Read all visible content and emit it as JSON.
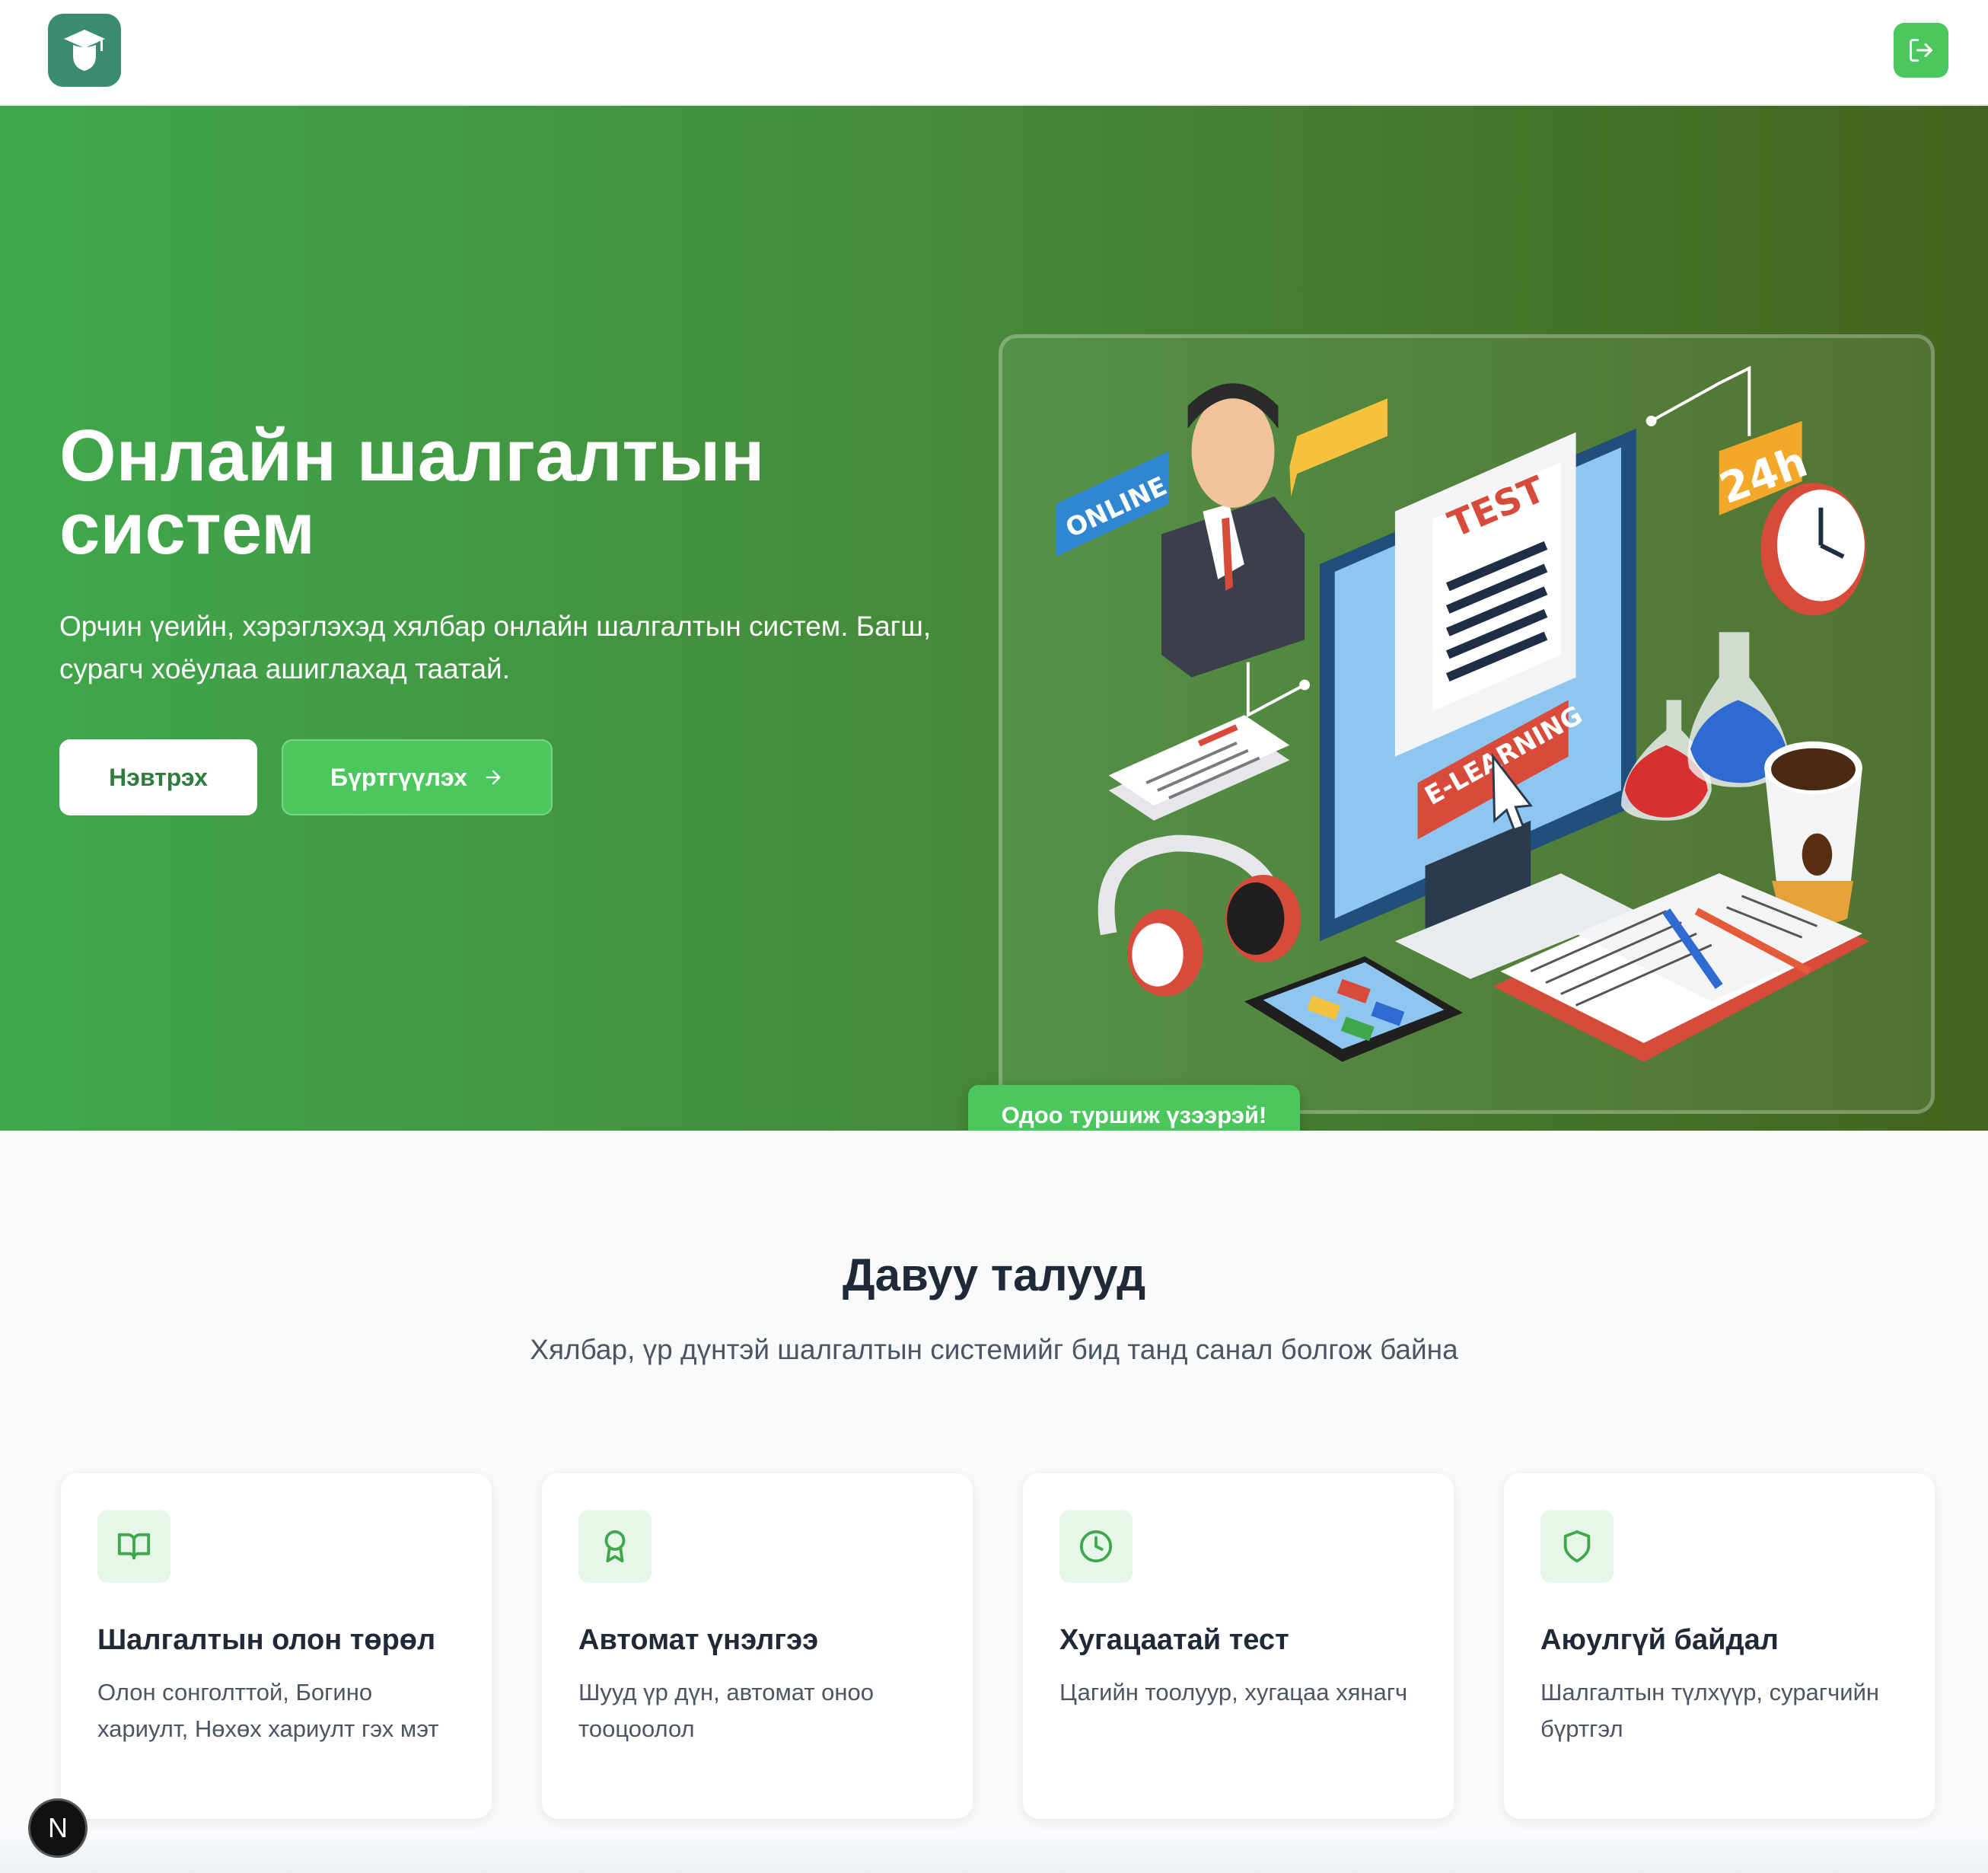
{
  "header": {
    "logo_icon": "graduate-logo-icon",
    "logout_icon": "logout-icon"
  },
  "hero": {
    "title": "Онлайн шалгалтын систем",
    "subtitle": "Орчин үеийн, хэрэглэхэд хялбар онлайн шалгалтын систем. Багш, сурагч хоёулаа ашиглахад таатай.",
    "login_label": "Нэвтрэх",
    "register_label": "Бүртгүүлэх",
    "register_icon": "arrow-right-icon",
    "try_badge": "Одоо туршиж үзээрэй!",
    "illustration": {
      "online_text": "ONLINE",
      "test_text": "TEST",
      "elearning_text": "E-LEARNING",
      "hours_text": "24h"
    }
  },
  "features": {
    "title": "Давуу талууд",
    "subtitle": "Хялбар, үр дүнтэй шалгалтын системийг бид танд санал болгож байна",
    "items": [
      {
        "icon": "book-open-icon",
        "title": "Шалгалтын олон төрөл",
        "description": "Олон сонголттой, Богино хариулт, Нөхөх хариулт гэх мэт"
      },
      {
        "icon": "award-icon",
        "title": "Автомат үнэлгээ",
        "description": "Шууд үр дүн, автомат оноо тооцоолол"
      },
      {
        "icon": "clock-icon",
        "title": "Хугацаатай тест",
        "description": "Цагийн тоолуур, хугацаа хянагч"
      },
      {
        "icon": "shield-icon",
        "title": "Аюулгүй байдал",
        "description": "Шалгалтын түлхүүр, сурагчийн бүртгэл"
      }
    ]
  },
  "dev_badge": "N",
  "colors": {
    "accent_green": "#4cc75e",
    "hero_start": "#3fa84c",
    "hero_end": "#44651f",
    "logo_bg": "#3b8c6e"
  }
}
